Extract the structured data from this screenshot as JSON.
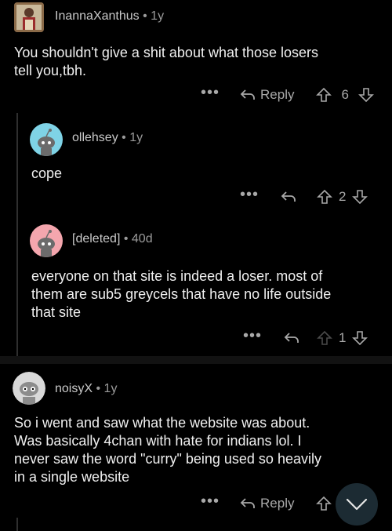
{
  "comments": [
    {
      "author": "InannaXanthus",
      "age": "1y",
      "text_lines": [
        "You shouldn't give a shit about what those losers",
        "tell you,tbh."
      ],
      "reply_label": "Reply",
      "votes": "6",
      "avatar": "painting-avatar"
    },
    {
      "author": "ollehsey",
      "age": "1y",
      "text_lines": [
        "cope"
      ],
      "votes": "2",
      "avatar": "snoo-blue"
    },
    {
      "author": "[deleted]",
      "age": "40d",
      "text_lines": [
        "everyone on that site is indeed a loser. most of",
        "them are sub5 greycels that have no life outside",
        "that site"
      ],
      "votes": "1",
      "avatar": "snoo-pink"
    },
    {
      "author": "noisyX",
      "age": "1y",
      "text_lines": [
        "So i went and saw what the website was about.",
        "Was basically 4chan with hate for indians lol. I",
        "never saw the word \"curry\" being used so heavily",
        "in a single website"
      ],
      "reply_label": "Reply",
      "avatar": "snoo-grey"
    }
  ],
  "separator": "•",
  "more_label": "•••",
  "colors": {
    "background": "#000000",
    "text": "#f0f0f0",
    "muted": "#9a9a9a",
    "fab": "#1c2b33"
  }
}
